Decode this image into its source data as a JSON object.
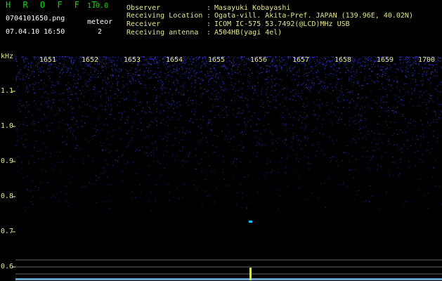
{
  "header": {
    "app_title": "H R O F F T",
    "app_version": "1.0.0",
    "file_name": "0704101650.png",
    "date_time": "07.04.10 16:50",
    "meteor_label": "meteor",
    "meteor_count": "2"
  },
  "info": [
    {
      "label": "Observer",
      "value": "Masayuki Kobayashi"
    },
    {
      "label": "Receiving Location",
      "value": "Ogata-vill. Akita-Pref. JAPAN (139.96E, 40.02N)"
    },
    {
      "label": "Receiver",
      "value": "ICOM IC-575 53.7492(@LCD)MHz USB"
    },
    {
      "label": "Receiving antenna",
      "value": "A504HB(yagi 4el)"
    }
  ],
  "colors": {
    "header_green": "#00e000",
    "label_yellow": "#e6e68c",
    "signal_blue": "#3c3cff",
    "meteor_cyan": "#00c8ff",
    "marker_green": "#d0ff00"
  },
  "chart_data": {
    "type": "heatmap",
    "xlabel": "",
    "ylabel": "kHz",
    "x_ticks": [
      "1651",
      "1652",
      "1653",
      "1654",
      "1655",
      "1656",
      "1657",
      "1658",
      "1659",
      "1700"
    ],
    "y_ticks": [
      "1.1",
      "1.0",
      "0.9",
      "0.8",
      "0.7",
      "0.6"
    ],
    "y_range_khz": [
      0.58,
      1.2
    ],
    "meteors": [
      {
        "time": "1655.8",
        "freq_khz": 0.73
      },
      {
        "time": "1655.8",
        "freq_khz": 0.58
      }
    ]
  }
}
